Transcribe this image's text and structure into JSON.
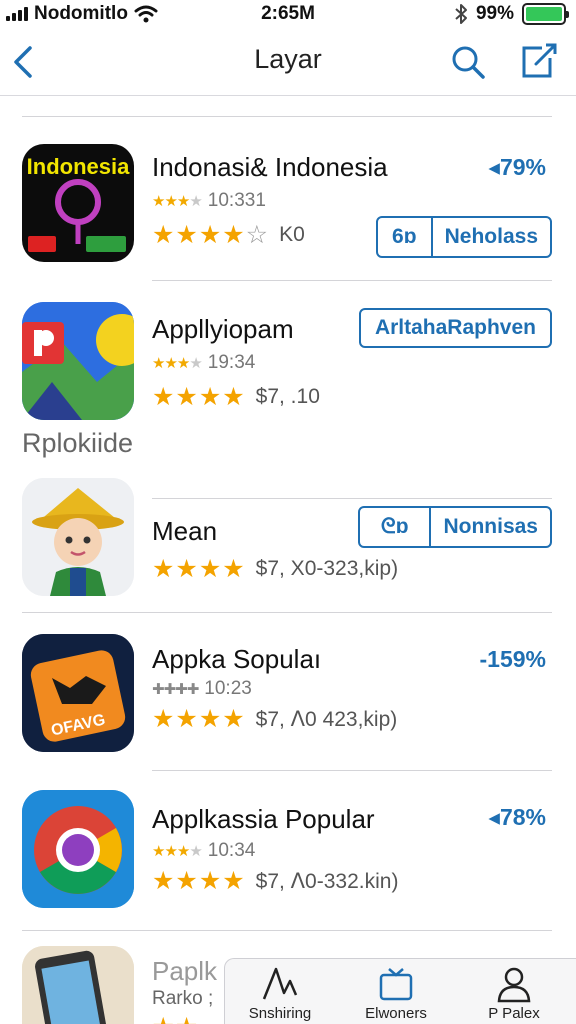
{
  "status": {
    "carrier": "Nodomitlo",
    "time": "2:65M",
    "battery": "99%",
    "battery_level": 0.99
  },
  "nav": {
    "title": "Layar"
  },
  "section_label": "Rplokiide",
  "apps": [
    {
      "name": "Indonasi& Indonesia",
      "icon_text": "Indonesia",
      "meta": "10:331",
      "rating_text": "K0",
      "stars": 4,
      "percent": "◂79%",
      "buttons": [
        "6ɒ",
        "Neholass"
      ]
    },
    {
      "name": "Appllyiopam",
      "meta": "19:34",
      "rating_text": "$7, .10",
      "stars": 4,
      "button": "ArltahaRaphven"
    },
    {
      "name": "Mean",
      "rating_text": "$7, X0-323,kip)",
      "stars": 4,
      "buttons": [
        "ᘓɒ",
        "Nonnisas"
      ]
    },
    {
      "name": "Appka Sopulaı",
      "icon_text": "OFAVG",
      "meta": "10:23",
      "rating_text": "$7, ᐱ0 423,kip)",
      "stars": 4,
      "percent": "-159%"
    },
    {
      "name": "Applkassia  Popular",
      "meta": "10:34",
      "rating_text": "$7, ᐱ0-332.kin)",
      "stars": 4,
      "percent": "◂78%"
    },
    {
      "name": "Paplk",
      "meta": "Rarko ;"
    }
  ],
  "tabs": [
    {
      "label": "Snshiring",
      "icon": "activity-icon"
    },
    {
      "label": "Elwoners",
      "icon": "updates-icon"
    },
    {
      "label": "P Palex",
      "icon": "person-icon"
    }
  ],
  "colors": {
    "accent": "#1f6fb2",
    "star": "#f4a300",
    "battery": "#34c759"
  }
}
